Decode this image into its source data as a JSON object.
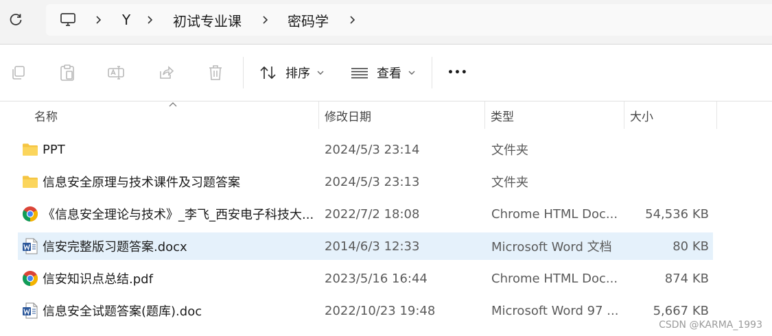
{
  "breadcrumb": [
    "Y",
    "初试专业课",
    "密码学"
  ],
  "toolbar": {
    "sort_label": "排序",
    "view_label": "查看",
    "more_label": "•••"
  },
  "columns": {
    "name": "名称",
    "modified": "修改日期",
    "type": "类型",
    "size": "大小"
  },
  "files": [
    {
      "name": "PPT",
      "modified": "2024/5/3 23:14",
      "type": "文件夹",
      "size": "",
      "icon": "folder-icon"
    },
    {
      "name": "信息安全原理与技术课件及习题答案",
      "modified": "2024/5/3 23:13",
      "type": "文件夹",
      "size": "",
      "icon": "folder-icon"
    },
    {
      "name": "《信息安全理论与技术》_李飞_西安电子科技大...",
      "modified": "2022/7/2 18:08",
      "type": "Chrome HTML Doc...",
      "size": "54,536 KB",
      "icon": "chrome-icon"
    },
    {
      "name": "信安完整版习题答案.docx",
      "modified": "2014/6/3 12:33",
      "type": "Microsoft Word 文档",
      "size": "80 KB",
      "icon": "word-icon"
    },
    {
      "name": "信安知识点总结.pdf",
      "modified": "2023/5/16 16:44",
      "type": "Chrome HTML Doc...",
      "size": "874 KB",
      "icon": "chrome-icon"
    },
    {
      "name": "信息安全试题答案(题库).doc",
      "modified": "2022/10/23 19:48",
      "type": "Microsoft Word 97 ...",
      "size": "5,667 KB",
      "icon": "word-icon"
    }
  ],
  "selected_index": 3,
  "watermark": "CSDN @KARMA_1993",
  "colors": {
    "selected_row": "#e5f1fb",
    "folder": "#f5c543",
    "word_blue": "#2b579a"
  }
}
